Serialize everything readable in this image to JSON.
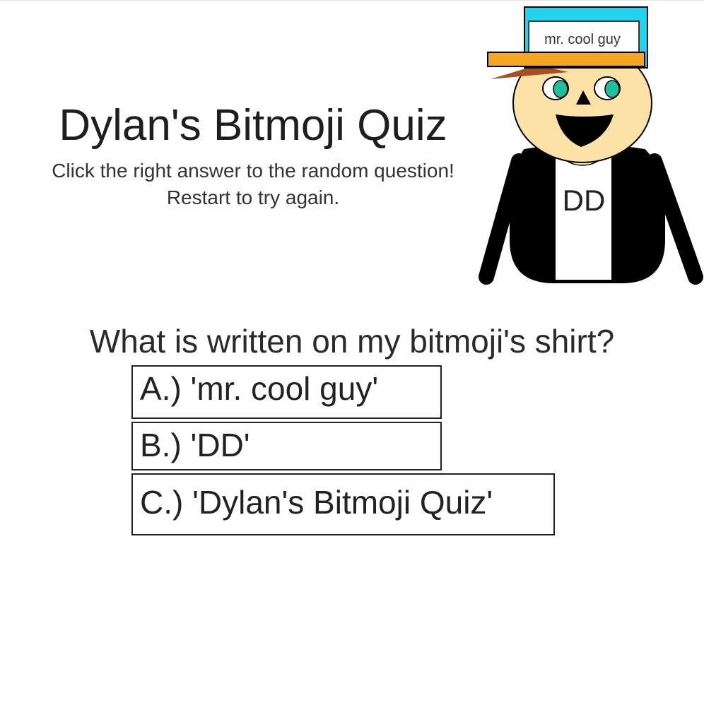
{
  "quiz": {
    "title": "Dylan's Bitmoji Quiz",
    "instructions": [
      "Click the right answer to the random question!",
      "Restart to try again."
    ]
  },
  "bitmoji": {
    "hat_label": "mr. cool guy",
    "shirt_text": "DD",
    "colors": {
      "hat_crown": "#22d3f0",
      "hat_brim": "#f5a623",
      "hair": "#a5511f",
      "skin": "#fde2a8",
      "iris": "#1fbf9f",
      "jacket": "#000000",
      "shirt": "#ffffff"
    }
  },
  "question": {
    "text": "What is written on my bitmoji's shirt?",
    "answers": [
      {
        "label": "A.) 'mr. cool guy'"
      },
      {
        "label": "B.) 'DD'"
      },
      {
        "label": "C.) 'Dylan's Bitmoji Quiz'"
      }
    ]
  }
}
